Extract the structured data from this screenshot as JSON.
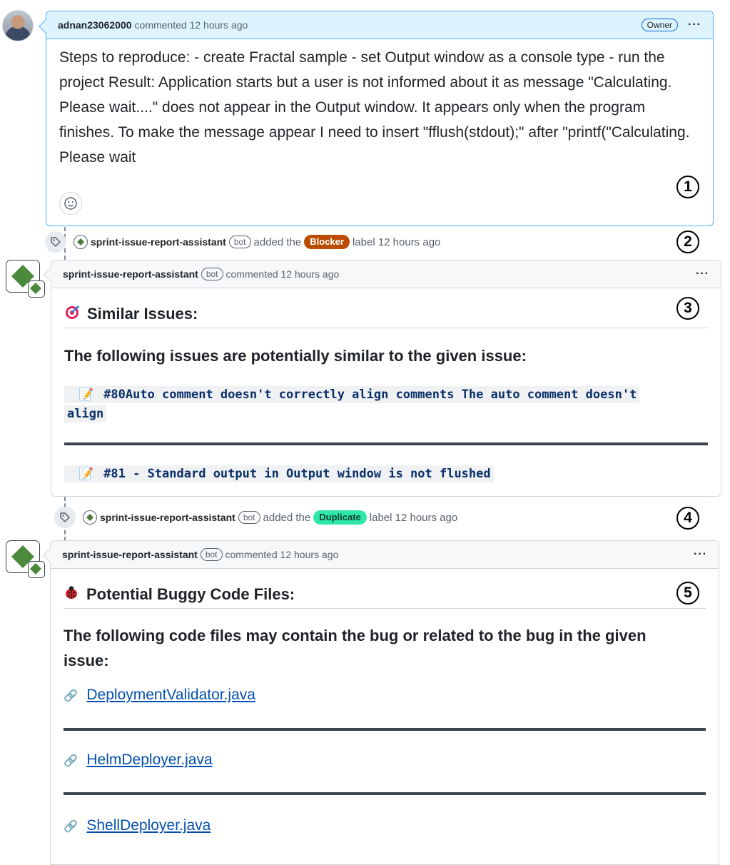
{
  "comment1": {
    "author": "adnan23062000",
    "meta": "commented 12 hours ago",
    "role_badge": "Owner",
    "body": "Steps to reproduce: - create Fractal sample - set Output window as a console type - run the project Result: Application starts but a user is not informed about it as message \"Calculating. Please wait....\" does not appear in the Output window. It appears only when the program finishes. To make the message appear I need to insert \"fflush(stdout);\" after \"printf(\"Calculating. Please wait",
    "marker": "1"
  },
  "event1": {
    "actor": "sprint-issue-report-assistant",
    "bot_badge": "bot",
    "pre": "added the",
    "label": "Blocker",
    "label_color": "#bc4c00",
    "post": "label 12 hours ago",
    "marker": "2"
  },
  "comment2": {
    "author": "sprint-issue-report-assistant",
    "bot_badge": "bot",
    "meta": "commented 12 hours ago",
    "heading": "Similar Issues:",
    "lead": "The following issues are potentially similar to the given issue:",
    "issue_a_line1": "#80Auto comment doesn't correctly align comments The auto comment doesn't",
    "issue_a_line2": "align",
    "issue_b": "#81 - Standard output in Output window is not flushed",
    "marker": "3"
  },
  "event2": {
    "actor": "sprint-issue-report-assistant",
    "bot_badge": "bot",
    "pre": "added the",
    "label": "Duplicate",
    "label_color": "#2ee6a8",
    "post": "label 12 hours ago",
    "marker": "4"
  },
  "comment3": {
    "author": "sprint-issue-report-assistant",
    "bot_badge": "bot",
    "meta": "commented 12 hours ago",
    "heading": "Potential Buggy Code Files:",
    "lead_line1": "The following code files may contain the bug or related to the bug in the given",
    "lead_line2": "issue:",
    "files": [
      "DeploymentValidator.java",
      "HelmDeployer.java",
      "ShellDeployer.java"
    ],
    "marker": "5"
  },
  "icons": {
    "more": "kebab-horizontal-icon",
    "tag": "tag-icon",
    "smiley": "smiley-icon",
    "target": "target-icon",
    "bug": "ladybug-icon",
    "link": "link-icon",
    "pencil": "memo-icon"
  }
}
